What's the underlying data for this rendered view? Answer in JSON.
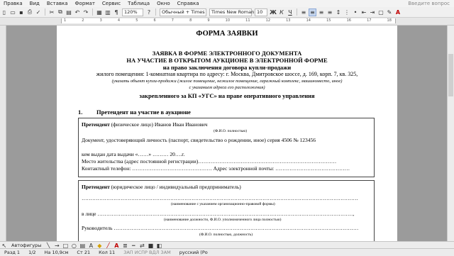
{
  "menu": {
    "items": [
      "Правка",
      "Вид",
      "Вставка",
      "Формат",
      "Сервис",
      "Таблица",
      "Окно",
      "Справка"
    ],
    "help_placeholder": "Введите вопрос"
  },
  "toolbar": {
    "zoom": "120%",
    "style": "Обычный + Times",
    "font": "Times New Roman",
    "size": "10"
  },
  "ruler": {
    "marks": [
      "1",
      "2",
      "3",
      "4",
      "5",
      "6",
      "7",
      "8",
      "9",
      "10",
      "11",
      "12",
      "13",
      "14",
      "15",
      "16",
      "17",
      "18"
    ]
  },
  "document": {
    "title": "ФОРМА ЗАЯВКИ",
    "heading1": "ЗАЯВКА В ФОРМЕ ЭЛЕКТРОННОГО ДОКУМЕНТА",
    "heading2": "НА УЧАСТИЕ В ОТКРЫТОМ АУКЦИОНЕ В ЭЛЕКТРОННОЙ ФОРМЕ",
    "heading3": "на право заключения договора купли-продажи",
    "object_line": "жилого помещения: 1-комнатная квартира по адресу: г. Москва, Дмитровское шоссе, д. 169, корп. 7, кв. 325,",
    "hint1": "(указать объект купли-продажи (жилое помещение, нежилое помещение, гаражный комплекс, машиноместо, иное)",
    "hint2": "с указанием адреса его расположения)",
    "assigned_line": "закрепленного за КП «УГС» на праве оперативного управления",
    "section1_number": "1.",
    "section1_title": "Претендент на участие в аукционе",
    "individual": {
      "label": "Претендент",
      "label_rest": " (физическое лицо) Иванов Иван Иванович",
      "fio_hint": "(Ф.И.О. полностью)",
      "id_doc": "Документ, удостоверяющий личность (паспорт, свидетельство о рождении, иное) серия 4506 № 123456",
      "issued": "кем выдан дата выдачи «……» ……… 20….г.",
      "residence": "Место жительства (адрес постоянной регистрации)……………………………………………………………………",
      "phone": "Контактный телефон: ……………………………………… Адрес электронной почты: ……………………………………"
    },
    "legal": {
      "label": "Претендент",
      "label_rest": " (юридическое лицо / индивидуальный предприниматель)",
      "name_line": "…………………………………………………………………………………………………………………………………………",
      "name_hint": "(наименование с указанием организационно-правовой формы)",
      "person_line": "в лице ………………………………………………………………………………………………………………………………,",
      "person_hint": "(наименование должности, Ф.И.О. уполномоченного лица полностью)",
      "head_line": "Руководитель …………………………………………………………………………………………………………………………",
      "head_hint": "(Ф.И.О. полностью, должность)"
    }
  },
  "drawbar": {
    "label": "Автофигуры"
  },
  "statusbar": {
    "section": "Разд 1",
    "page": "1/2",
    "position": "На 10,9см",
    "line": "Ст 21",
    "col": "Кол 11",
    "modes": "ЗАП  ИСПР  ВДЛ  ЗАМ",
    "language": "русский (Ро"
  }
}
